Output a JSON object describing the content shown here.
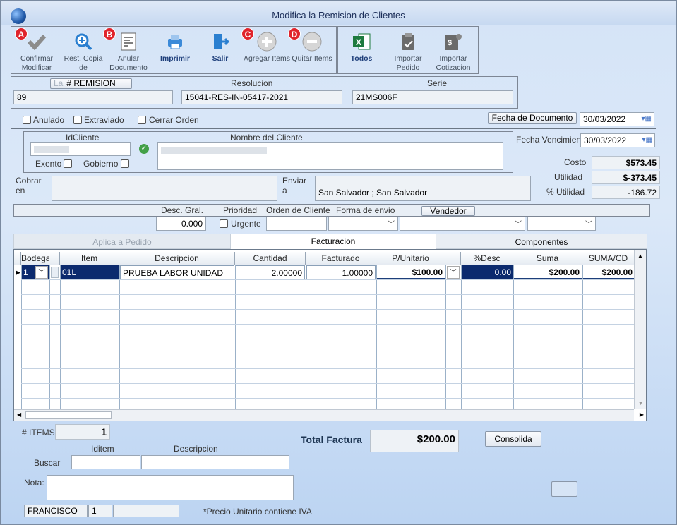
{
  "window": {
    "title": "Modifica la Remision de Clientes"
  },
  "toolbar": {
    "confirmar": "Confirmar Modificar",
    "rest_copia": "Rest. Copia de",
    "anular": "Anular Documento",
    "imprimir": "Imprimir",
    "salir": "Salir",
    "agregar": "Agregar Items",
    "quitar": "Quitar Items",
    "todos": "Todos",
    "importar_pedido": "Importar Pedido",
    "importar_cotizacion": "Importar Cotizacion",
    "badges": {
      "a": "A",
      "b": "B",
      "c": "C",
      "d": "D"
    }
  },
  "header": {
    "remision_label": "# REMISION",
    "remision_value": "89",
    "resolucion_label": "Resolucion",
    "resolucion_value": "15041-RES-IN-05417-2021",
    "serie_label": "Serie",
    "serie_value": "21MS006F",
    "faded": "La"
  },
  "flags": {
    "anulado": "Anulado",
    "extraviado": "Extraviado",
    "cerrar_orden": "Cerrar Orden"
  },
  "dates": {
    "fecha_doc_label": "Fecha de  Documento",
    "fecha_doc_value": "30/03/2022",
    "fecha_venc_label": "Fecha Vencimien",
    "fecha_venc_value": "30/03/2022"
  },
  "cliente": {
    "id_label": "IdCliente",
    "nombre_label": "Nombre del Cliente",
    "exento": "Exento",
    "gobierno": "Gobierno"
  },
  "cobrar": {
    "label": "Cobrar en",
    "enviar_label": "Enviar a",
    "enviar_value": "San Salvador ; San Salvador"
  },
  "totals_side": {
    "costo_label": "Costo",
    "costo_value": "$573.45",
    "utilidad_label": "Utilidad",
    "utilidad_value": "$-373.45",
    "pct_label": "% Utilidad",
    "pct_value": "-186.72"
  },
  "options": {
    "desc_gral_label": "Desc. Gral.",
    "desc_gral_value": "0.000",
    "prioridad_label": "Prioridad",
    "urgente": "Urgente",
    "orden_label": "Orden de Cliente",
    "forma_label": "Forma de envio",
    "vendedor": "Vendedor"
  },
  "tabs": {
    "aplica": "Aplica a Pedido",
    "facturacion": "Facturacion",
    "componentes": "Componentes"
  },
  "grid": {
    "headers": {
      "bodega": "Bodega",
      "item": "Item",
      "descripcion": "Descripcion",
      "cantidad": "Cantidad",
      "facturado": "Facturado",
      "unitario": "P/Unitario",
      "desc": "%Desc",
      "suma": "Suma",
      "suma_cd": "SUMA/CD"
    },
    "row": {
      "bodega": "1",
      "item": "01L",
      "descripcion": "PRUEBA LABOR UNIDAD",
      "cantidad": "2.00000",
      "facturado": "1.00000",
      "unitario": "$100.00",
      "desc": "0.00",
      "suma": "$200.00",
      "suma_cd": "$200.00"
    }
  },
  "footer": {
    "items_label": "# ITEMS",
    "items_value": "1",
    "total_label": "Total Factura",
    "total_value": "$200.00",
    "consolida": "Consolida",
    "iditem_label": "Iditem",
    "descripcion_label": "Descripcion",
    "buscar_label": "Buscar",
    "nota_label": "Nota:",
    "user": "FRANCISCO",
    "user_num": "1",
    "precio_note": "*Precio Unitario contiene IVA"
  },
  "colors": {
    "selected_row": "#0b2a6e",
    "badge": "#e0242c",
    "excel": "#1d7a3e"
  }
}
